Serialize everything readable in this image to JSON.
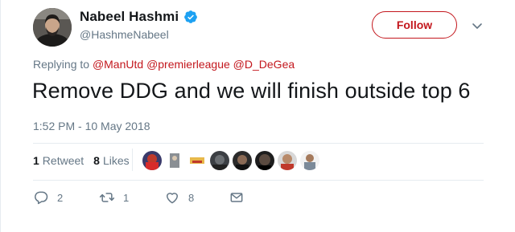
{
  "tweet": {
    "display_name": "Nabeel Hashmi",
    "handle": "@HashmeNabeel",
    "follow_label": "Follow",
    "replying_prefix": "Replying to",
    "mentions": [
      "@ManUtd",
      "@premierleague",
      "@D_DeGea"
    ],
    "text": "Remove DDG and we will finish outside top 6",
    "timestamp": "1:52 PM - 10 May 2018",
    "retweets": {
      "count": "1",
      "label": "Retweet"
    },
    "likes": {
      "count": "8",
      "label": "Likes"
    },
    "actions": {
      "reply_count": "2",
      "retweet_count": "1",
      "like_count": "8"
    }
  },
  "colors": {
    "accent": "#c3171d",
    "muted": "#657786",
    "text": "#14171a",
    "verified": "#1da1f2",
    "divider": "#e6ecf0"
  },
  "icons": {
    "verified": "verified-badge-icon",
    "caret": "chevron-down-icon",
    "reply": "reply-icon",
    "retweet": "retweet-icon",
    "like": "heart-icon",
    "dm": "envelope-icon"
  }
}
